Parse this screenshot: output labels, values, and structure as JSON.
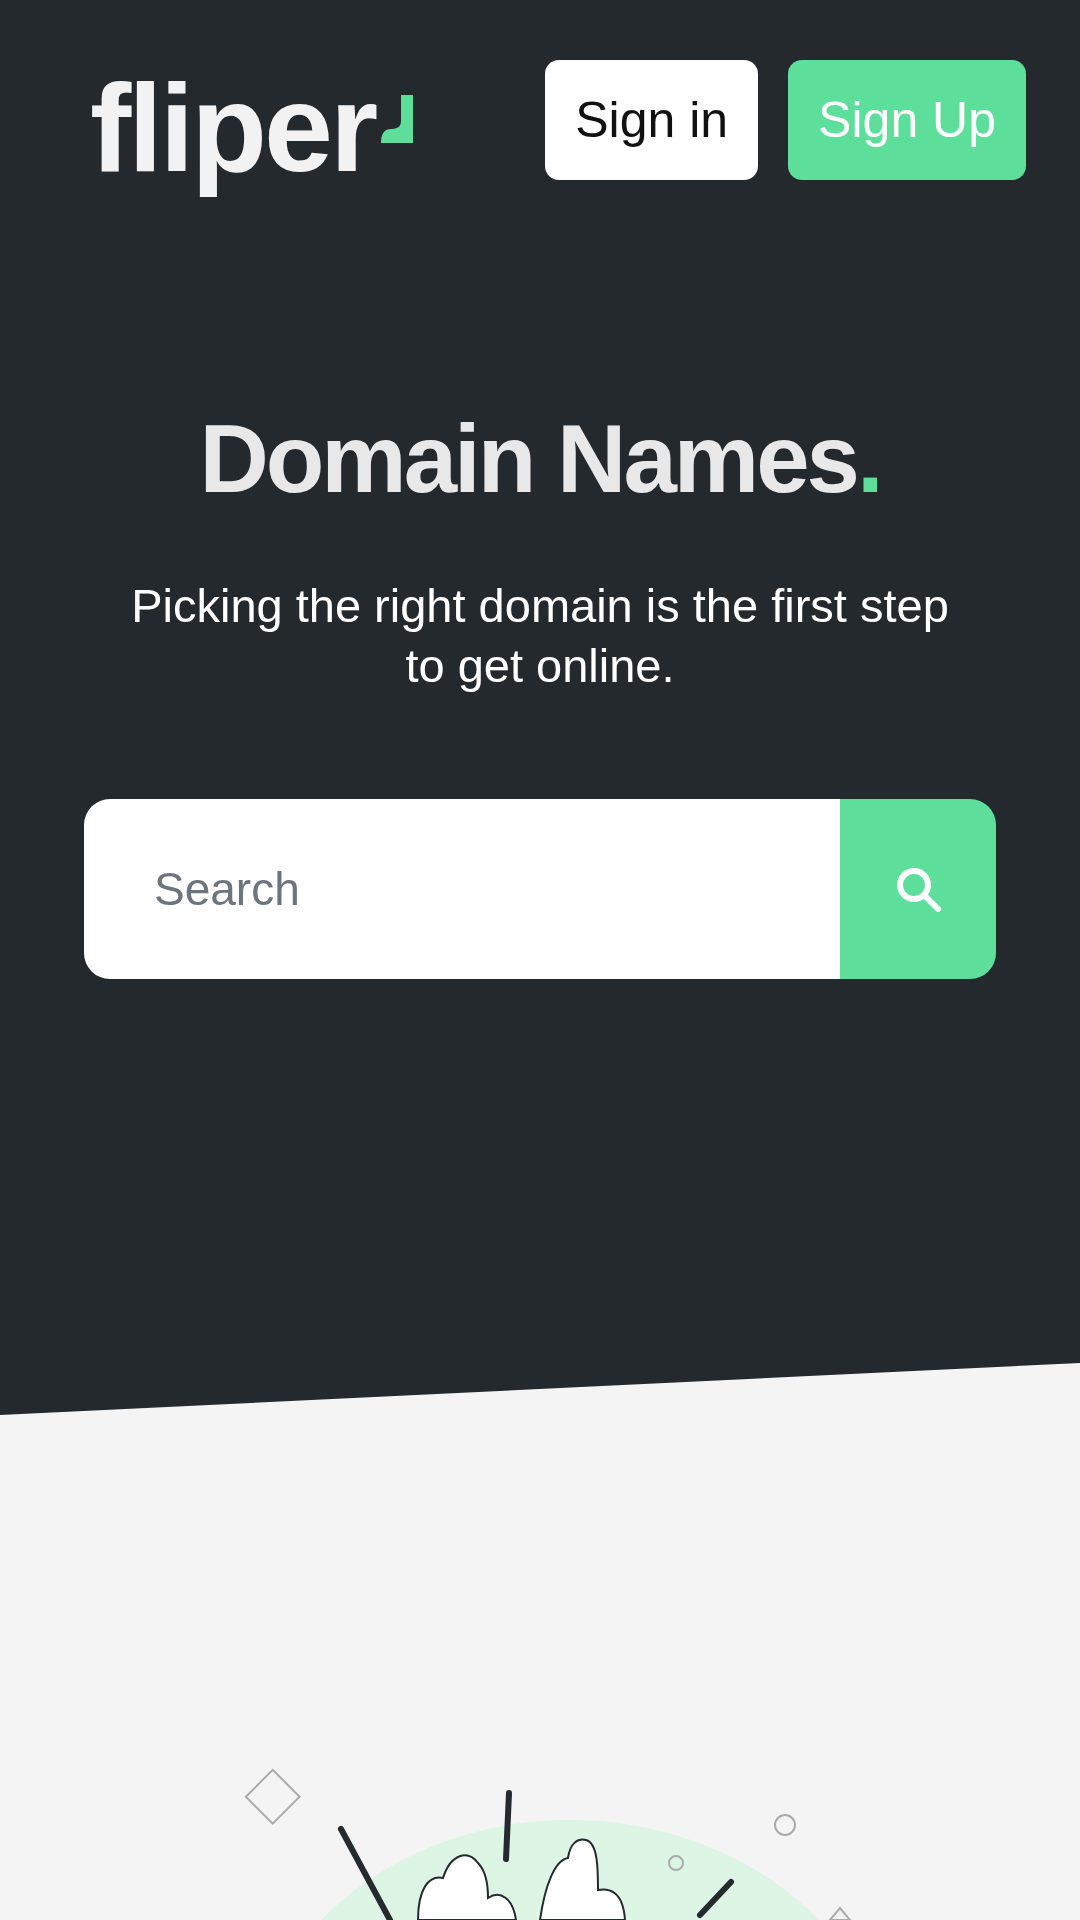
{
  "header": {
    "logo": {
      "text": "fliper"
    },
    "buttons": [
      {
        "label": "Sign in",
        "kind": "outline"
      },
      {
        "label": "Sign Up",
        "kind": "primary"
      }
    ]
  },
  "hero": {
    "title": "Domain Names",
    "title_dot": ".",
    "subtitle": "Picking the right domain is the first step to get online.",
    "search": {
      "placeholder": "Search"
    }
  }
}
